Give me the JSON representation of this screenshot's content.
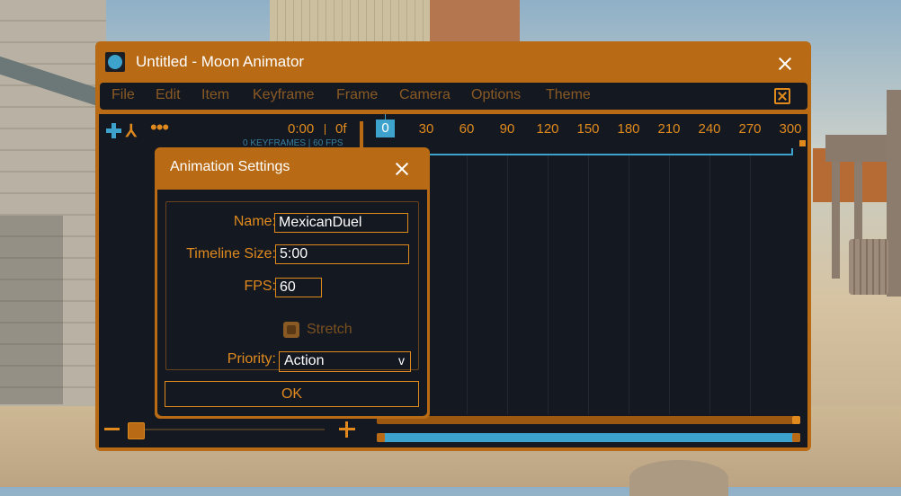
{
  "window": {
    "title": "Untitled - Moon Animator",
    "menu": [
      "File",
      "Edit",
      "Item",
      "Keyframe",
      "Frame",
      "Camera",
      "Options",
      "Theme"
    ]
  },
  "toolbar": {
    "time": "0:00",
    "frame": "0f",
    "info": "0 KEYFRAMES | 60 FPS"
  },
  "timeline": {
    "ticks": [
      "0",
      "30",
      "60",
      "90",
      "120",
      "150",
      "180",
      "210",
      "240",
      "270",
      "300"
    ]
  },
  "dialog": {
    "title": "Animation Settings",
    "name_label": "Name:",
    "name_value": "MexicanDuel",
    "size_label": "Timeline Size:",
    "size_value": "5:00",
    "fps_label": "FPS:",
    "fps_value": "60",
    "stretch_label": "Stretch",
    "priority_label": "Priority:",
    "priority_value": "Action",
    "priority_arrow": "v",
    "ok_label": "OK"
  },
  "colors": {
    "accent": "#e08a1e",
    "frame": "#b86a14",
    "panel": "#141821",
    "highlight": "#3da3cd"
  },
  "icons": {
    "app": "moon-icon",
    "close": "close-icon",
    "add": "plus-icon",
    "rig": "rig-icon",
    "more": "more-icon",
    "zoom_out": "minus-icon",
    "zoom_in": "plus-icon"
  }
}
